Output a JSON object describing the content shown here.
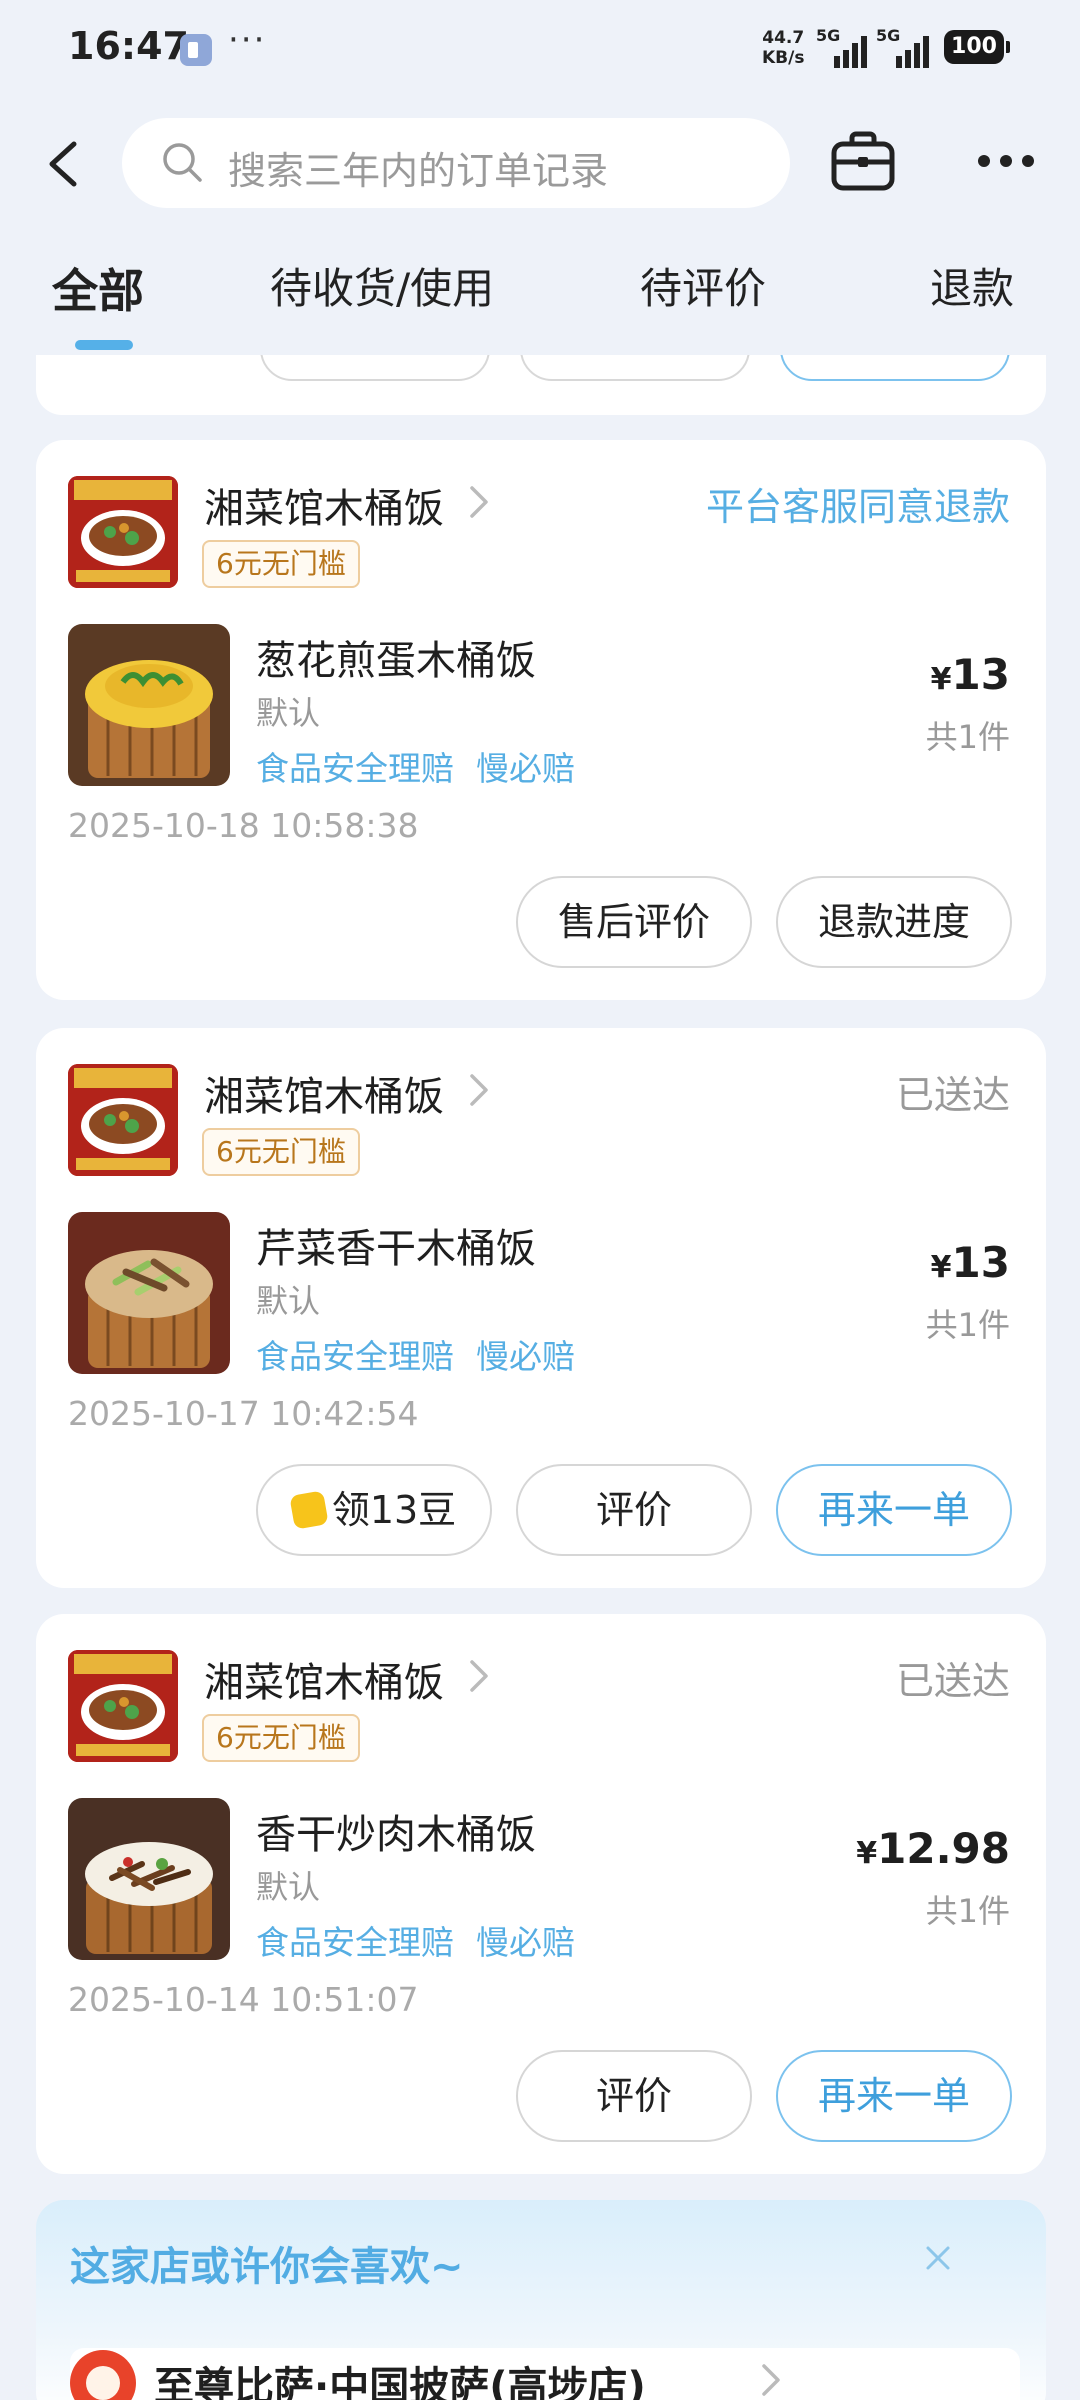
{
  "status_bar": {
    "time": "16:47",
    "dots": "···",
    "speed_top": "44.7",
    "speed_bottom": "KB/s",
    "sim1": "5G",
    "sim2": "5G",
    "battery": "100"
  },
  "search": {
    "placeholder": "搜索三年内的订单记录"
  },
  "tabs": [
    "全部",
    "待收货/使用",
    "待评价",
    "退款"
  ],
  "orders": [
    {
      "shop_name": "湘菜馆木桶饭",
      "coupon": "6元无门槛",
      "status": "平台客服同意退款",
      "status_color": "#56aee3",
      "food_name": "葱花煎蛋木桶饭",
      "spec": "默认",
      "tags": [
        "食品安全理赔",
        "慢必赔"
      ],
      "currency": "¥",
      "price": "13",
      "qty": "共1件",
      "time": "2025-10-18 10:58:38",
      "buttons": [
        "售后评价",
        "退款进度"
      ]
    },
    {
      "shop_name": "湘菜馆木桶饭",
      "coupon": "6元无门槛",
      "status": "已送达",
      "status_color": "#999999",
      "food_name": "芹菜香干木桶饭",
      "spec": "默认",
      "tags": [
        "食品安全理赔",
        "慢必赔"
      ],
      "currency": "¥",
      "price": "13",
      "qty": "共1件",
      "time": "2025-10-17 10:42:54",
      "buttons": [
        "领13豆",
        "评价",
        "再来一单"
      ]
    },
    {
      "shop_name": "湘菜馆木桶饭",
      "coupon": "6元无门槛",
      "status": "已送达",
      "status_color": "#999999",
      "food_name": "香干炒肉木桶饭",
      "spec": "默认",
      "tags": [
        "食品安全理赔",
        "慢必赔"
      ],
      "currency": "¥",
      "price": "12.98",
      "qty": "共1件",
      "time": "2025-10-14 10:51:07",
      "buttons": [
        "评价",
        "再来一单"
      ]
    }
  ],
  "recommend": {
    "title": "这家店或许你会喜欢~",
    "shop_name": "至尊比萨·中国披萨(高埗店)"
  },
  "colors": {
    "accent": "#56aee3",
    "background": "#eef2f9",
    "coupon": "#b8761c"
  }
}
